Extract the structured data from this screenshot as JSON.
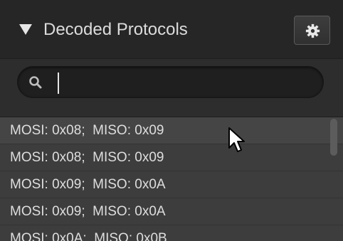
{
  "header": {
    "title": "Decoded Protocols",
    "collapse_icon": "triangle-down-icon",
    "settings_icon": "gear-icon"
  },
  "search": {
    "value": "",
    "placeholder": "",
    "icon": "search-icon"
  },
  "list": {
    "items": [
      {
        "label": "MOSI: 0x08;  MISO: 0x09"
      },
      {
        "label": "MOSI: 0x08;  MISO: 0x09"
      },
      {
        "label": "MOSI: 0x09;  MISO: 0x0A"
      },
      {
        "label": "MOSI: 0x09;  MISO: 0x0A"
      },
      {
        "label": "MOSI: 0x0A;  MISO: 0x0B"
      }
    ]
  },
  "colors": {
    "background": "#2b2b2b",
    "row_odd": "#454545",
    "row_even": "#3d3d3d",
    "text": "#dedede"
  }
}
